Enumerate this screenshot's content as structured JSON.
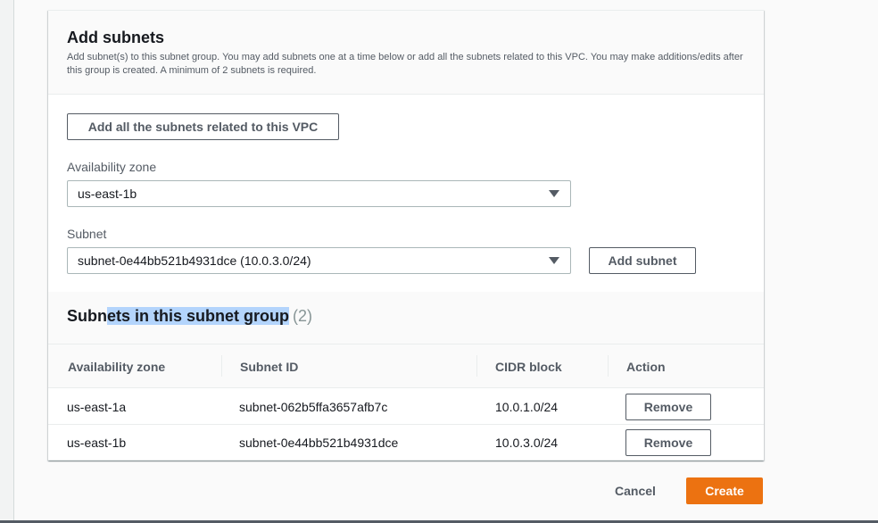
{
  "add_subnets": {
    "title": "Add subnets",
    "description": "Add subnet(s) to this subnet group. You may add subnets one at a time below or add all the subnets related to this VPC. You may make additions/edits after this group is created. A minimum of 2 subnets is required.",
    "add_all_button": "Add all the subnets related to this VPC",
    "az_label": "Availability zone",
    "az_value": "us-east-1b",
    "subnet_label": "Subnet",
    "subnet_value": "subnet-0e44bb521b4931dce (10.0.3.0/24)",
    "add_subnet_button": "Add subnet"
  },
  "subnet_table": {
    "title_prefix": "Subn",
    "title_highlighted": "ets in this subnet group",
    "count": "(2)",
    "columns": [
      "Availability zone",
      "Subnet ID",
      "CIDR block",
      "Action"
    ],
    "rows": [
      {
        "az": "us-east-1a",
        "subnet_id": "subnet-062b5ffa3657afb7c",
        "cidr": "10.0.1.0/24",
        "action": "Remove"
      },
      {
        "az": "us-east-1b",
        "subnet_id": "subnet-0e44bb521b4931dce",
        "cidr": "10.0.3.0/24",
        "action": "Remove"
      }
    ]
  },
  "footer": {
    "cancel": "Cancel",
    "create": "Create"
  },
  "colors": {
    "primary": "#ec7211",
    "selection_highlight": "#b3d4fc"
  },
  "icons": {
    "dropdown": "caret-down-icon"
  }
}
